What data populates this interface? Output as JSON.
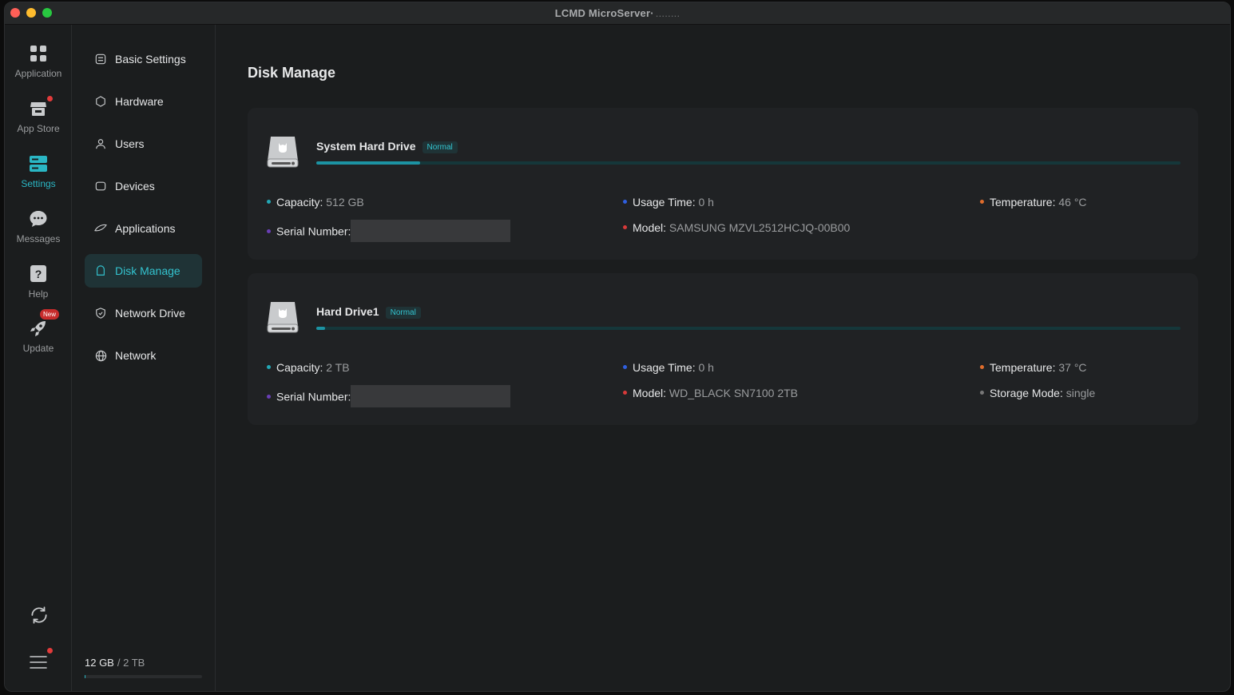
{
  "window": {
    "title": "LCMD MicroServer·",
    "title_suffix": "........"
  },
  "rail": {
    "items": [
      {
        "label": "Application",
        "icon": "grid-icon"
      },
      {
        "label": "App Store",
        "icon": "store-icon"
      },
      {
        "label": "Settings",
        "icon": "server-icon"
      },
      {
        "label": "Messages",
        "icon": "chat-icon"
      },
      {
        "label": "Help",
        "icon": "help-icon"
      },
      {
        "label": "Update",
        "icon": "rocket-icon",
        "badge": "New"
      }
    ]
  },
  "sidebar": {
    "items": [
      {
        "label": "Basic Settings",
        "icon": "sliders-icon"
      },
      {
        "label": "Hardware",
        "icon": "hexagon-icon"
      },
      {
        "label": "Users",
        "icon": "user-icon"
      },
      {
        "label": "Devices",
        "icon": "device-icon"
      },
      {
        "label": "Applications",
        "icon": "app-icon"
      },
      {
        "label": "Disk Manage",
        "icon": "disk-icon"
      },
      {
        "label": "Network Drive",
        "icon": "shield-icon"
      },
      {
        "label": "Network",
        "icon": "globe-icon"
      }
    ],
    "storage": {
      "used": "12 GB",
      "total": "/ 2 TB",
      "fraction": 0.006
    }
  },
  "main": {
    "title": "Disk Manage",
    "drives": [
      {
        "name": "System Hard Drive",
        "status": "Normal",
        "usage_fraction": 0.12,
        "capacity_label": "Capacity:",
        "capacity": "512 GB",
        "usage_label": "Usage Time:",
        "usage": "0 h",
        "temp_label": "Temperature:",
        "temp": "46 °C",
        "serial_label": "Serial Number:",
        "model_label": "Model:",
        "model": "SAMSUNG MZVL2512HCJQ-00B00"
      },
      {
        "name": "Hard Drive1",
        "status": "Normal",
        "usage_fraction": 0.01,
        "capacity_label": "Capacity:",
        "capacity": "2 TB",
        "usage_label": "Usage Time:",
        "usage": "0 h",
        "temp_label": "Temperature:",
        "temp": "37 °C",
        "serial_label": "Serial Number:",
        "model_label": "Model:",
        "model": "WD_BLACK SN7100 2TB",
        "mode_label": "Storage Mode:",
        "mode": "single"
      }
    ]
  },
  "colors": {
    "accent": "#2ab6c4",
    "background": "#1b1d1e",
    "card": "#202224"
  }
}
